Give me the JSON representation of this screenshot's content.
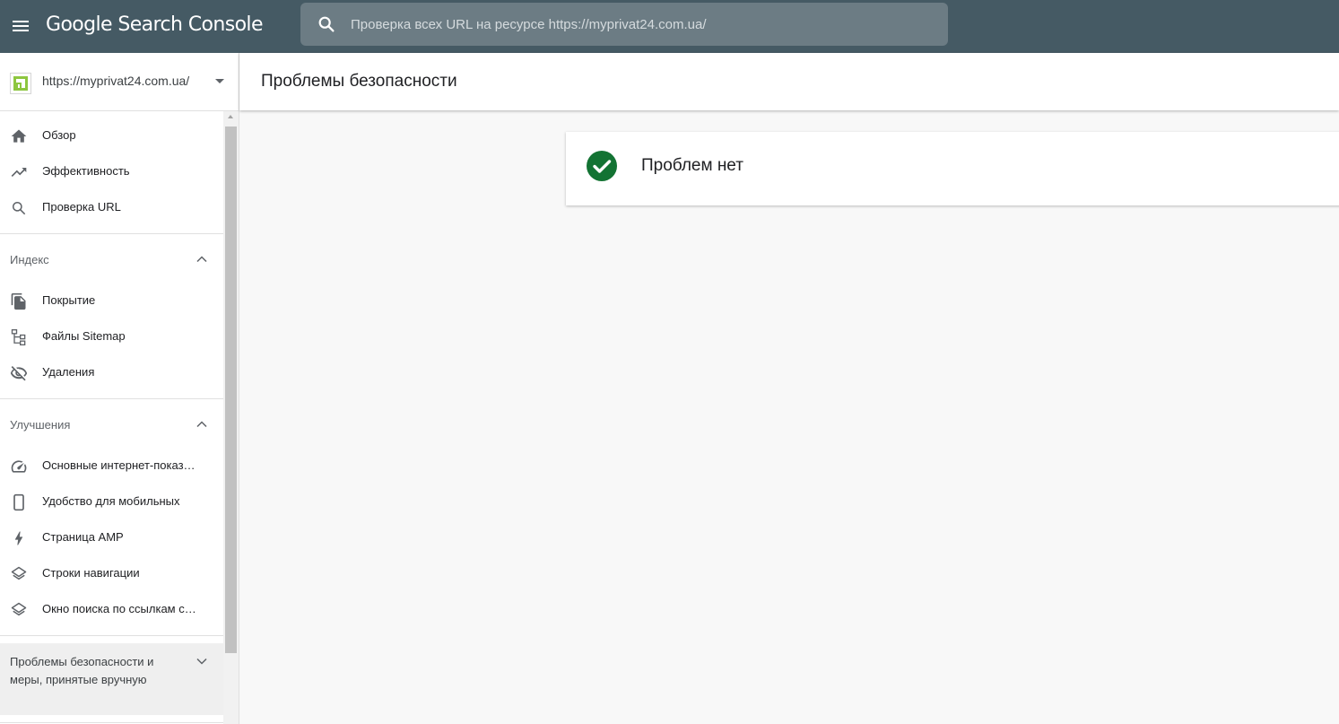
{
  "header": {
    "logo_text": "Google Search Console",
    "search_placeholder": "Проверка всех URL на ресурсе https://myprivat24.com.ua/"
  },
  "property": {
    "url": "https://myprivat24.com.ua/"
  },
  "sidebar": {
    "top_items": [
      {
        "label": "Обзор",
        "icon": "home-icon"
      },
      {
        "label": "Эффективность",
        "icon": "trending-up-icon"
      },
      {
        "label": "Проверка URL",
        "icon": "search-icon"
      }
    ],
    "index": {
      "title": "Индекс",
      "items": [
        {
          "label": "Покрытие",
          "icon": "file-copy-icon"
        },
        {
          "label": "Файлы Sitemap",
          "icon": "sitemap-icon"
        },
        {
          "label": "Удаления",
          "icon": "visibility-off-icon"
        }
      ]
    },
    "enhancements": {
      "title": "Улучшения",
      "items": [
        {
          "label": "Основные интернет-показ…",
          "icon": "speed-gauge-icon"
        },
        {
          "label": "Удобство для мобильных",
          "icon": "smartphone-icon"
        },
        {
          "label": "Страница AMP",
          "icon": "bolt-icon"
        },
        {
          "label": "Строки навигации",
          "icon": "layers-icon"
        },
        {
          "label": "Окно поиска по ссылкам с…",
          "icon": "layers-icon"
        }
      ]
    },
    "security": {
      "title": "Проблемы безопасности и меры, принятые вручную"
    }
  },
  "main": {
    "page_title": "Проблемы безопасности",
    "status_text": "Проблем нет",
    "status_color": "#137333"
  },
  "colors": {
    "header_bg": "#455a64",
    "search_bg": "#6c7c84",
    "sidebar_bg": "#ffffff",
    "content_bg": "#f8f8f8",
    "favicon_green": "#8dc63f"
  }
}
